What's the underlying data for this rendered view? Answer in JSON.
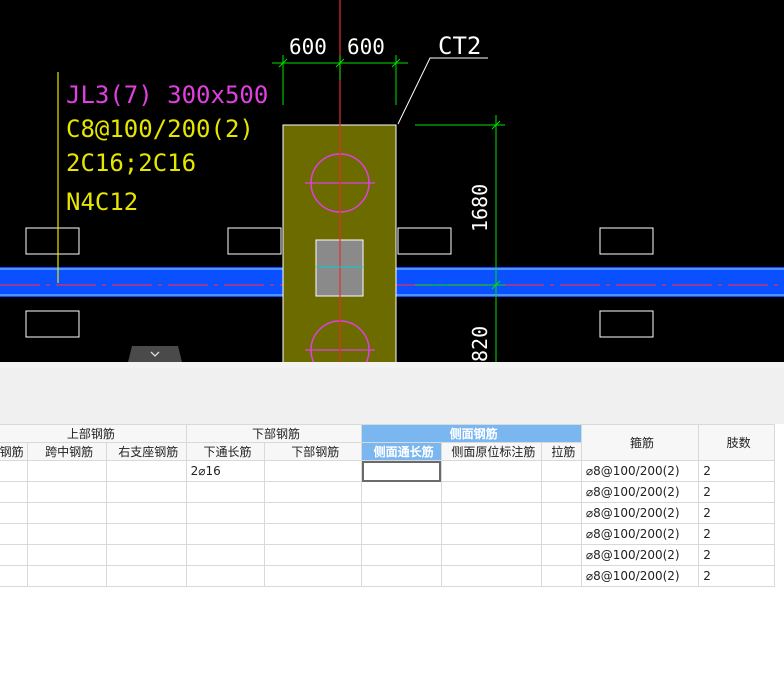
{
  "cad": {
    "beam_label": "JL3(7) 300x500",
    "stirrup": "C8@100/200(2)",
    "top_bars": "2C16;2C16",
    "side_bars": "N4C12",
    "cap_label": "CT2",
    "dim_left": "600",
    "dim_right": "600",
    "dim_vertical": "1680",
    "dim_vertical2": "820",
    "colors": {
      "magenta": "#e040e0",
      "yellow": "#e6e600",
      "green": "#00e000",
      "blue": "#0a50ff",
      "cap_fill": "#6b6b00"
    }
  },
  "grid": {
    "groups": {
      "top": "上部钢筋",
      "bottom": "下部钢筋",
      "side": "侧面钢筋",
      "stirrup": "箍筋",
      "legs": "肢数"
    },
    "columns": {
      "c0": "钢筋",
      "c1": "跨中钢筋",
      "c2": "右支座钢筋",
      "c3": "下通长筋",
      "c4": "下部钢筋",
      "c5": "侧面通长筋",
      "c6": "侧面原位标注筋",
      "c7": "拉筋"
    },
    "rows": [
      {
        "bottom_through": "2⌀16",
        "stirrup": "⌀8@100/200(2)",
        "legs": "2"
      },
      {
        "bottom_through": "",
        "stirrup": "⌀8@100/200(2)",
        "legs": "2"
      },
      {
        "bottom_through": "",
        "stirrup": "⌀8@100/200(2)",
        "legs": "2"
      },
      {
        "bottom_through": "",
        "stirrup": "⌀8@100/200(2)",
        "legs": "2"
      },
      {
        "bottom_through": "",
        "stirrup": "⌀8@100/200(2)",
        "legs": "2"
      },
      {
        "bottom_through": "",
        "stirrup": "⌀8@100/200(2)",
        "legs": "2"
      }
    ]
  }
}
